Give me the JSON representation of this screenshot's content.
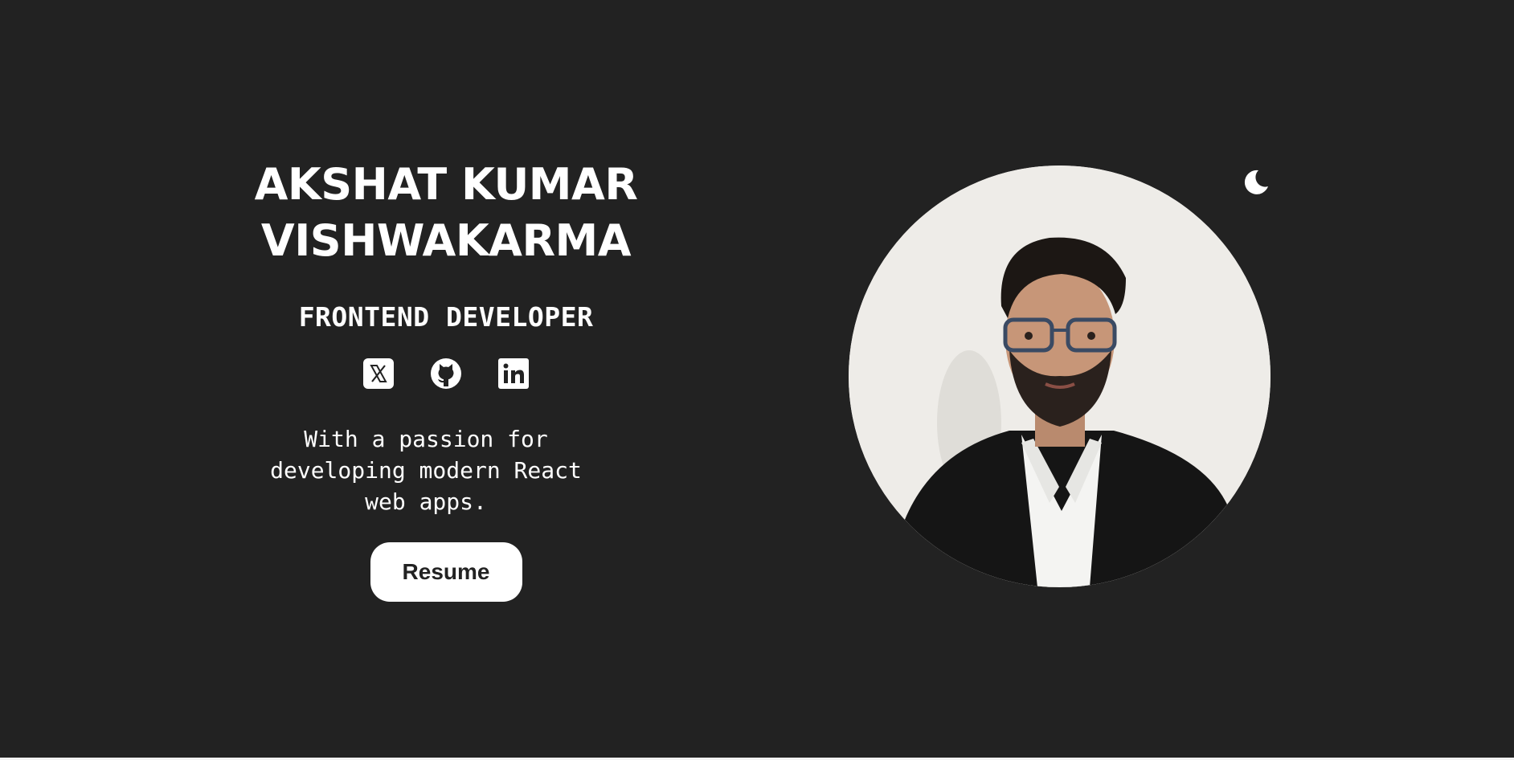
{
  "hero": {
    "name_line1": "AKSHAT KUMAR",
    "name_line2": "VISHWAKARMA",
    "role": "FRONTEND DEVELOPER",
    "tagline": "With a passion for developing modern React web apps.",
    "resume_label": "Resume",
    "socials": [
      {
        "icon": "x-twitter-icon"
      },
      {
        "icon": "github-icon"
      },
      {
        "icon": "linkedin-icon"
      }
    ]
  },
  "theme_toggle": {
    "icon": "moon-icon"
  },
  "colors": {
    "background": "#222222",
    "text": "#ffffff",
    "button_background": "#ffffff",
    "button_text": "#222222"
  }
}
